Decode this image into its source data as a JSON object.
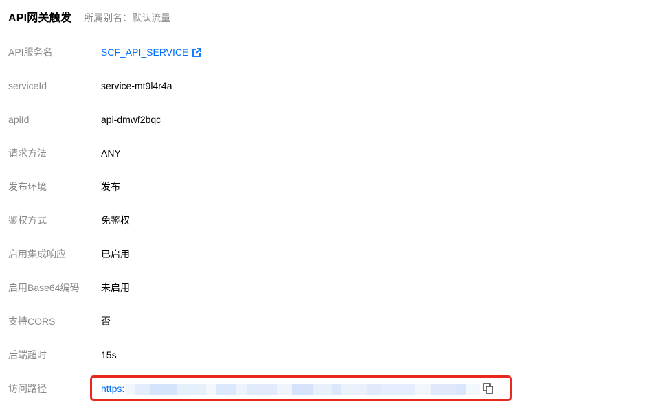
{
  "header": {
    "title": "API网关触发",
    "subtitle": "所属别名：默认流量"
  },
  "details": [
    {
      "label": "API服务名",
      "value": "SCF_API_SERVICE",
      "is_link": true
    },
    {
      "label": "serviceId",
      "value": "service-mt9l4r4a"
    },
    {
      "label": "apiId",
      "value": "api-dmwf2bqc"
    },
    {
      "label": "请求方法",
      "value": "ANY"
    },
    {
      "label": "发布环境",
      "value": "发布"
    },
    {
      "label": "鉴权方式",
      "value": "免鉴权"
    },
    {
      "label": "启用集成响应",
      "value": "已启用"
    },
    {
      "label": "启用Base64编码",
      "value": "未启用"
    },
    {
      "label": "支持CORS",
      "value": "否"
    },
    {
      "label": "后端超时",
      "value": "15s"
    }
  ],
  "access_path": {
    "label": "访问路径",
    "url_visible": "https:"
  },
  "colors": {
    "link": "#006eff",
    "label": "#888888",
    "highlight": "#e8281e"
  },
  "icons": {
    "external_link": "external-link-icon",
    "copy": "copy-icon"
  }
}
